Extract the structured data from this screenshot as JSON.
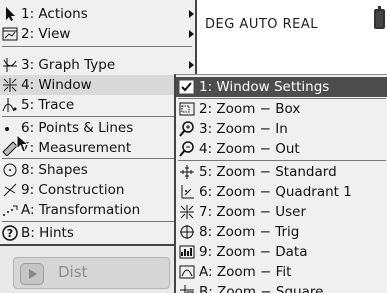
{
  "status": {
    "mode_text": "DEG AUTO REAL"
  },
  "entry": {
    "text": "Dist"
  },
  "main_menu": {
    "items": [
      {
        "label": "1: Actions",
        "icon": "pointer-arrow-icon"
      },
      {
        "label": "2: View",
        "icon": "view-icon"
      },
      {
        "label": "3: Graph Type",
        "icon": "graph-type-icon"
      },
      {
        "label": "4: Window",
        "icon": "window-icon"
      },
      {
        "label": "5: Trace",
        "icon": "trace-icon"
      },
      {
        "label": "6: Points & Lines",
        "icon": "point-icon"
      },
      {
        "label": "7: Measurement",
        "icon": "ruler-icon"
      },
      {
        "label": "8: Shapes",
        "icon": "circle-icon"
      },
      {
        "label": "9: Construction",
        "icon": "construction-icon"
      },
      {
        "label": "A: Transformation",
        "icon": "transformation-icon"
      },
      {
        "label": "B: Hints",
        "icon": "help-icon"
      }
    ]
  },
  "sub_menu": {
    "items": [
      {
        "label": "1: Window Settings",
        "icon": "checkbox-icon"
      },
      {
        "label": "2: Zoom − Box",
        "icon": "zoom-box-icon"
      },
      {
        "label": "3: Zoom − In",
        "icon": "zoom-in-icon"
      },
      {
        "label": "4: Zoom − Out",
        "icon": "zoom-out-icon"
      },
      {
        "label": "5: Zoom − Standard",
        "icon": "zoom-standard-icon"
      },
      {
        "label": "6: Zoom − Quadrant 1",
        "icon": "zoom-quadrant-icon"
      },
      {
        "label": "7: Zoom − User",
        "icon": "zoom-user-icon"
      },
      {
        "label": "8: Zoom − Trig",
        "icon": "zoom-trig-icon"
      },
      {
        "label": "9: Zoom − Data",
        "icon": "zoom-data-icon"
      },
      {
        "label": "A: Zoom − Fit",
        "icon": "zoom-fit-icon"
      },
      {
        "label": "B: Zoom − Square",
        "icon": "zoom-square-icon"
      }
    ]
  }
}
